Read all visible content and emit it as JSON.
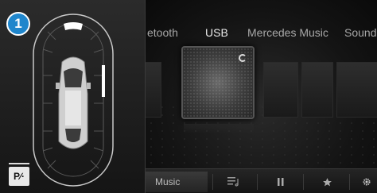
{
  "badge": {
    "number": "1"
  },
  "parking": {
    "button_label": "P∕·"
  },
  "media": {
    "tabs": [
      {
        "label": "etooth",
        "active": false
      },
      {
        "label": "USB",
        "active": true
      },
      {
        "label": "Mercedes Music",
        "active": false
      },
      {
        "label": "Sound",
        "active": false
      }
    ],
    "bottom": {
      "music_label": "Music",
      "icons": [
        "playlist-icon",
        "pause-icon",
        "star-icon",
        "gear-icon"
      ]
    }
  },
  "colors": {
    "badge_blue": "#1f86cc",
    "background": "#111111"
  }
}
